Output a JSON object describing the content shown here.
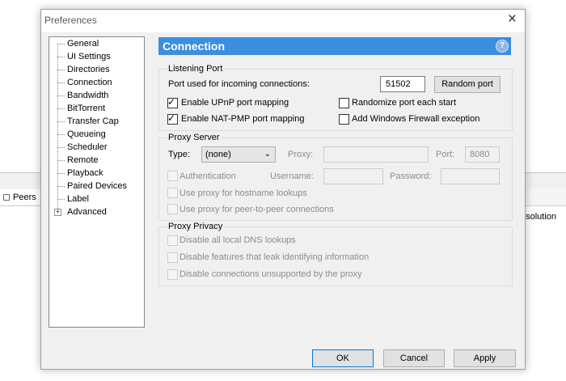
{
  "dialog": {
    "title": "Preferences",
    "tree": [
      {
        "label": "General"
      },
      {
        "label": "UI Settings"
      },
      {
        "label": "Directories"
      },
      {
        "label": "Connection"
      },
      {
        "label": "Bandwidth"
      },
      {
        "label": "BitTorrent"
      },
      {
        "label": "Transfer Cap"
      },
      {
        "label": "Queueing"
      },
      {
        "label": "Scheduler"
      },
      {
        "label": "Remote"
      },
      {
        "label": "Playback"
      },
      {
        "label": "Paired Devices"
      },
      {
        "label": "Label"
      },
      {
        "label": "Advanced",
        "expander": "+"
      }
    ],
    "header": {
      "title": "Connection",
      "help": "?"
    },
    "listening": {
      "group_label": "Listening Port",
      "port_label": "Port used for incoming connections:",
      "port_value": "51502",
      "random_button": "Random port",
      "upnp_label": "Enable UPnP port mapping",
      "natpmp_label": "Enable NAT-PMP port mapping",
      "randomize_label": "Randomize port each start",
      "firewall_label": "Add Windows Firewall exception",
      "upnp_checked": true,
      "natpmp_checked": true,
      "randomize_checked": false,
      "firewall_checked": false
    },
    "proxy": {
      "group_label": "Proxy Server",
      "type_label": "Type:",
      "type_value": "(none)",
      "proxy_label": "Proxy:",
      "proxy_value": "",
      "port_label": "Port:",
      "port_value": "8080",
      "auth_label": "Authentication",
      "username_label": "Username:",
      "username_value": "",
      "password_label": "Password:",
      "password_value": "",
      "hostname_label": "Use proxy for hostname lookups",
      "p2p_label": "Use proxy for peer-to-peer connections"
    },
    "privacy": {
      "group_label": "Proxy Privacy",
      "dns_label": "Disable all local DNS lookups",
      "leak_label": "Disable features that leak identifying information",
      "unsupported_label": "Disable connections unsupported by the proxy"
    },
    "footer": {
      "ok": "OK",
      "cancel": "Cancel",
      "apply": "Apply"
    }
  },
  "background": {
    "tab_label": "Peers",
    "column_label": "esolution"
  },
  "colors": {
    "header_bg": "#3c8ede",
    "dialog_bg": "#f0f0f0"
  }
}
